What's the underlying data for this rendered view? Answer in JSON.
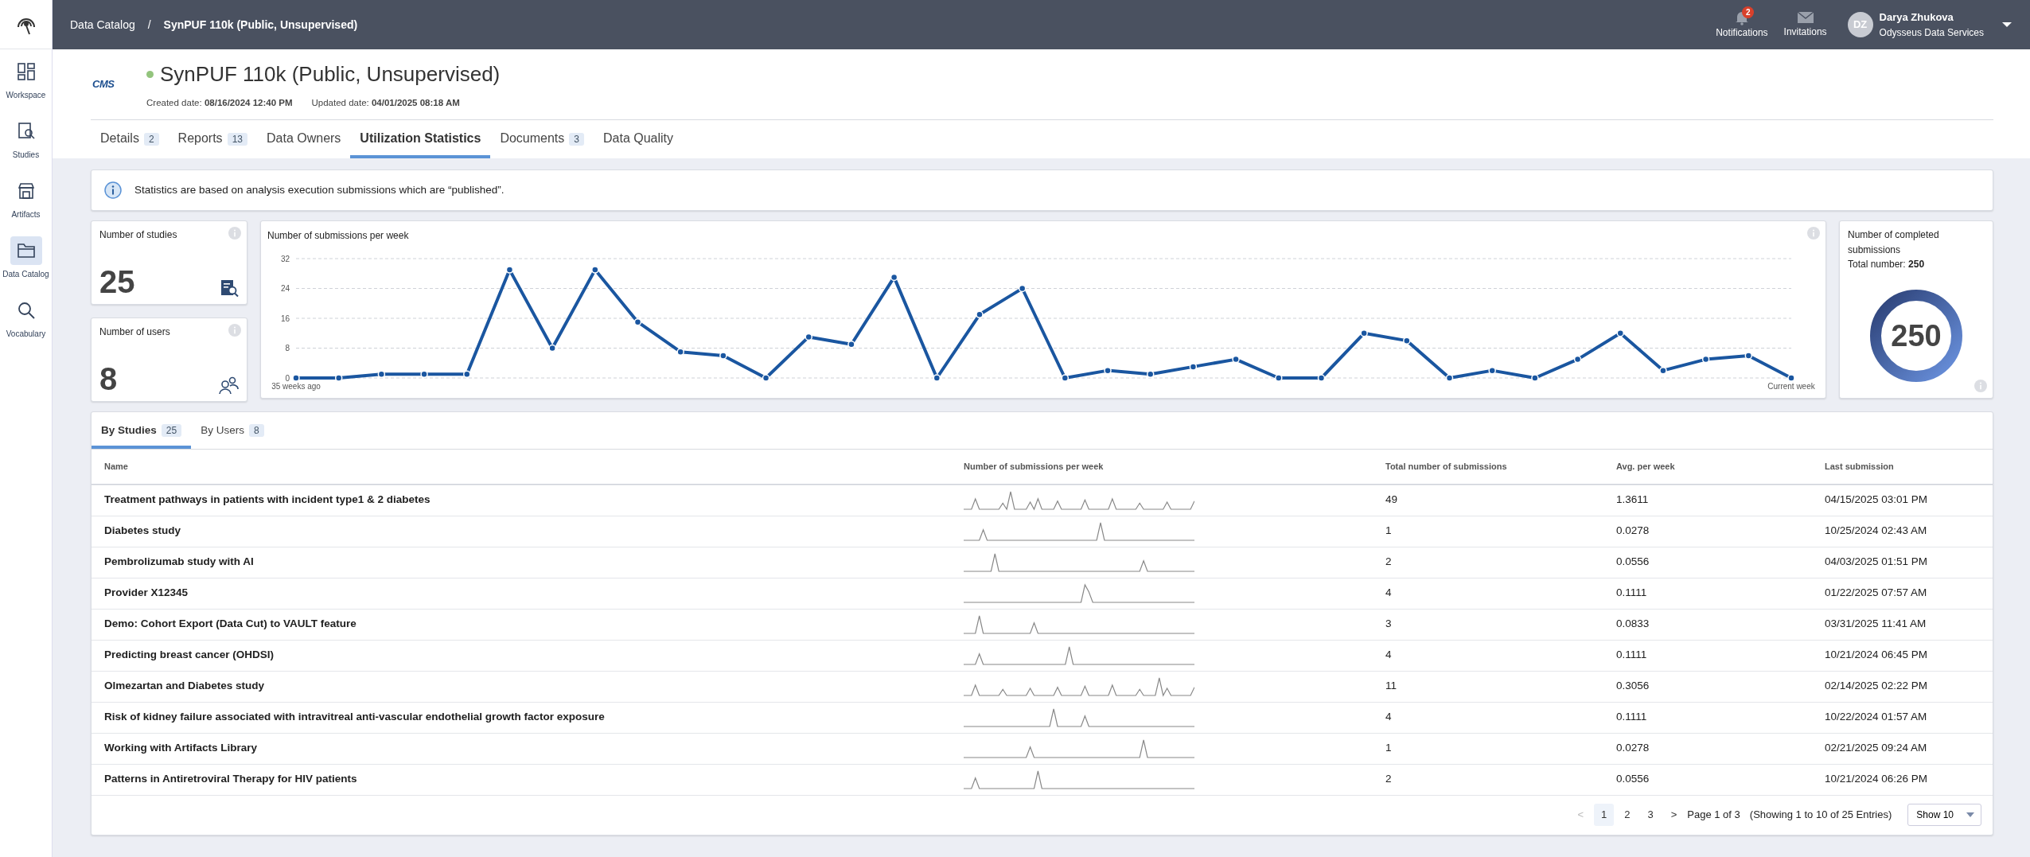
{
  "topbar": {
    "breadcrumb": [
      {
        "label": "Data Catalog"
      },
      {
        "label": "SynPUF 110k (Public, Unsupervised)"
      }
    ],
    "separator": "/",
    "notifications": {
      "label": "Notifications",
      "badge": "2"
    },
    "invitations": {
      "label": "Invitations"
    },
    "user": {
      "initials": "DZ",
      "name": "Darya Zhukova",
      "org": "Odysseus Data Services"
    }
  },
  "sidebar": {
    "items": [
      {
        "label": "Workspace",
        "kind": "workspace",
        "selected": false
      },
      {
        "label": "Studies",
        "kind": "studies",
        "selected": false
      },
      {
        "label": "Artifacts",
        "kind": "artifacts",
        "selected": false
      },
      {
        "label": "Data Catalog",
        "kind": "catalog",
        "selected": true
      },
      {
        "label": "Vocabulary",
        "kind": "vocabulary",
        "selected": false
      }
    ]
  },
  "header": {
    "logo": "CMS",
    "title": "SynPUF 110k (Public, Unsupervised)",
    "created_label": "Created date:",
    "created": "08/16/2024 12:40 PM",
    "updated_label": "Updated date:",
    "updated": "04/01/2025 08:18 AM"
  },
  "tabs": [
    {
      "label": "Details",
      "count": "2",
      "selected": false
    },
    {
      "label": "Reports",
      "count": "13",
      "selected": false
    },
    {
      "label": "Data Owners",
      "selected": false
    },
    {
      "label": "Utilization Statistics",
      "selected": true
    },
    {
      "label": "Documents",
      "count": "3",
      "selected": false
    },
    {
      "label": "Data Quality",
      "selected": false
    }
  ],
  "info": "Statistics are based on analysis execution submissions which are “published”.",
  "stats": [
    {
      "label": "Number of studies",
      "value": "25",
      "kind": "studies"
    },
    {
      "label": "Number of users",
      "value": "8",
      "kind": "users"
    }
  ],
  "weekly": {
    "title": "Number of submissions per week",
    "chart_data": {
      "type": "line",
      "categories": [
        "35 weeks ago",
        null,
        null,
        null,
        null,
        null,
        null,
        null,
        null,
        null,
        null,
        null,
        null,
        null,
        null,
        null,
        null,
        null,
        null,
        null,
        null,
        null,
        null,
        null,
        null,
        null,
        null,
        null,
        null,
        null,
        null,
        null,
        null,
        null,
        null,
        "Current week"
      ],
      "series": [
        {
          "color": "#1a56a0",
          "marker": "circle",
          "values": [
            0,
            0,
            1,
            1,
            1,
            29,
            8,
            29,
            15,
            7,
            6,
            0,
            11,
            9,
            27,
            0,
            17,
            24,
            0,
            2,
            1,
            3,
            5,
            0,
            0,
            12,
            10,
            0,
            2,
            0,
            5,
            12,
            2,
            5,
            6,
            0
          ]
        }
      ],
      "ylim": [
        0,
        32
      ],
      "yticks": [
        0,
        8,
        16,
        24,
        32
      ],
      "grid": true
    }
  },
  "completed": {
    "label": "Number of completed submissions",
    "total_label": "Total number:",
    "total": "250",
    "center": "250"
  },
  "table_tabs": [
    {
      "label": "By Studies",
      "count": "25",
      "selected": true
    },
    {
      "label": "By Users",
      "count": "8",
      "selected": false
    }
  ],
  "table": {
    "columns": [
      "Name",
      "Number of submissions per week",
      "Total number of submissions",
      "Avg. per week",
      "Last submission"
    ],
    "rows": [
      [
        "Treatment pathways in patients with incident type1 & 2 diabetes",
        "",
        "49",
        "1.3611",
        "04/15/2025 03:01 PM"
      ],
      [
        "Diabetes study",
        "",
        "1",
        "0.0278",
        "10/25/2024 02:43 AM"
      ],
      [
        "Pembrolizumab study with AI",
        "",
        "2",
        "0.0556",
        "04/03/2025 01:51 PM"
      ],
      [
        "Provider X12345",
        "",
        "4",
        "0.1111",
        "01/22/2025 07:57 AM"
      ],
      [
        "Demo: Cohort Export (Data Cut) to VAULT feature",
        "",
        "3",
        "0.0833",
        "03/31/2025 11:41 AM"
      ],
      [
        "Predicting breast cancer (OHDSI)",
        "",
        "4",
        "0.1111",
        "10/21/2024 06:45 PM"
      ],
      [
        "Olmezartan and Diabetes study",
        "",
        "11",
        "0.3056",
        "02/14/2025 02:22 PM"
      ],
      [
        "Risk of kidney failure associated with intravitreal anti-vascular endothelial growth factor exposure",
        "",
        "4",
        "0.1111",
        "10/22/2024 01:57 AM"
      ],
      [
        "Working with Artifacts Library",
        "",
        "1",
        "0.0278",
        "02/21/2025 09:24 AM"
      ],
      [
        "Patterns in Antiretroviral Therapy for HIV patients",
        "",
        "2",
        "0.0556",
        "10/21/2024 06:26 PM"
      ]
    ]
  },
  "pagination": {
    "prev": "<",
    "pages": [
      {
        "label": "1",
        "selected": true
      },
      {
        "label": "2",
        "selected": false
      },
      {
        "label": "3",
        "selected": false
      }
    ],
    "next": ">",
    "summary": "Page 1 of 3",
    "showing": "(Showing 1 to 10 of 25 Entries)",
    "page_size": "Show 10"
  }
}
